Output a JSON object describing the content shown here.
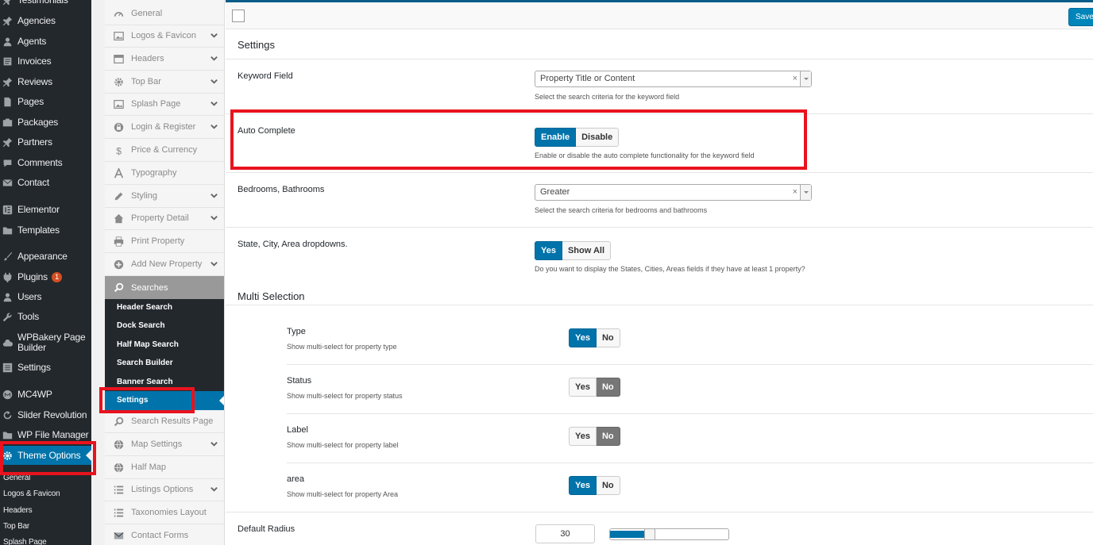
{
  "wp_menu": {
    "items": [
      {
        "label": "Testimonials",
        "icon": "pin-icon"
      },
      {
        "label": "Agencies",
        "icon": "pin-icon"
      },
      {
        "label": "Agents",
        "icon": "user-icon"
      },
      {
        "label": "Invoices",
        "icon": "document-icon"
      },
      {
        "label": "Reviews",
        "icon": "pin-icon"
      },
      {
        "label": "Pages",
        "icon": "page-icon"
      },
      {
        "label": "Packages",
        "icon": "package-icon"
      },
      {
        "label": "Partners",
        "icon": "pin-icon"
      },
      {
        "label": "Comments",
        "icon": "comment-icon"
      },
      {
        "label": "Contact",
        "icon": "mail-icon"
      },
      {
        "label": "Elementor",
        "icon": "elementor-icon"
      },
      {
        "label": "Templates",
        "icon": "folder-icon"
      },
      {
        "label": "Appearance",
        "icon": "brush-icon"
      },
      {
        "label": "Plugins",
        "icon": "plug-icon",
        "badge": "1"
      },
      {
        "label": "Users",
        "icon": "user-icon"
      },
      {
        "label": "Tools",
        "icon": "wrench-icon"
      },
      {
        "label": "WPBakery Page Builder",
        "icon": "cloud-icon"
      },
      {
        "label": "Settings",
        "icon": "settings-icon"
      },
      {
        "label": "MC4WP",
        "icon": "mc4wp-icon"
      },
      {
        "label": "Slider Revolution",
        "icon": "refresh-icon"
      },
      {
        "label": "WP File Manager",
        "icon": "folder-icon"
      },
      {
        "label": "Theme Options",
        "icon": "gear-icon"
      }
    ],
    "submenu": [
      "General",
      "Logos & Favicon",
      "Headers",
      "Top Bar",
      "Splash Page"
    ]
  },
  "options_panel": {
    "items": [
      {
        "label": "General",
        "icon": "speedometer-icon",
        "chevron": false
      },
      {
        "label": "Logos & Favicon",
        "icon": "image-icon",
        "chevron": true
      },
      {
        "label": "Headers",
        "icon": "header-icon",
        "chevron": true
      },
      {
        "label": "Top Bar",
        "icon": "gear-icon",
        "chevron": true
      },
      {
        "label": "Splash Page",
        "icon": "image-icon",
        "chevron": true
      },
      {
        "label": "Login & Register",
        "icon": "lock-icon",
        "chevron": true
      },
      {
        "label": "Price & Currency",
        "icon": "dollar-icon",
        "chevron": false
      },
      {
        "label": "Typography",
        "icon": "font-icon",
        "chevron": false
      },
      {
        "label": "Styling",
        "icon": "pencil-icon",
        "chevron": true
      },
      {
        "label": "Property Detail",
        "icon": "home-icon",
        "chevron": true
      },
      {
        "label": "Print Property",
        "icon": "print-icon",
        "chevron": false
      },
      {
        "label": "Add New Property",
        "icon": "plus-icon",
        "chevron": true
      },
      {
        "label": "Searches",
        "icon": "search-icon",
        "chevron": false
      }
    ],
    "search_submenu": [
      "Header Search",
      "Dock Search",
      "Half Map Search",
      "Search Builder",
      "Banner Search",
      "Settings"
    ],
    "items_after": [
      {
        "label": "Search Results Page",
        "icon": "search-icon",
        "chevron": false
      },
      {
        "label": "Map Settings",
        "icon": "globe-icon",
        "chevron": true
      },
      {
        "label": "Half Map",
        "icon": "globe-icon",
        "chevron": false
      },
      {
        "label": "Listings Options",
        "icon": "list-icon",
        "chevron": true
      },
      {
        "label": "Taxonomies Layout",
        "icon": "list-icon",
        "chevron": false
      },
      {
        "label": "Contact Forms",
        "icon": "mail-icon",
        "chevron": false
      }
    ]
  },
  "toolbar": {
    "save_label": "Save"
  },
  "settings": {
    "title": "Settings",
    "keyword_field": {
      "label": "Keyword Field",
      "value": "Property Title or Content",
      "clear": "×",
      "desc": "Select the search criteria for the keyword field"
    },
    "auto_complete": {
      "label": "Auto Complete",
      "enable": "Enable",
      "disable": "Disable",
      "desc": "Enable or disable the auto complete functionality for the keyword field"
    },
    "bedrooms": {
      "label": "Bedrooms, Bathrooms",
      "value": "Greater",
      "clear": "×",
      "desc": "Select the search criteria for bedrooms and bathrooms"
    },
    "dropdowns": {
      "label": "State, City, Area dropdowns.",
      "yes": "Yes",
      "show_all": "Show All",
      "desc": "Do you want to display the States, Cities, Areas fields if they have at least 1 property?"
    },
    "multi_title": "Multi Selection",
    "multi": [
      {
        "label": "Type",
        "desc": "Show multi-select for property type",
        "yes": "Yes",
        "no": "No",
        "selected": "yes"
      },
      {
        "label": "Status",
        "desc": "Show multi-select for property status",
        "yes": "Yes",
        "no": "No",
        "selected": "no"
      },
      {
        "label": "Label",
        "desc": "Show multi-select for property label",
        "yes": "Yes",
        "no": "No",
        "selected": "no"
      },
      {
        "label": "area",
        "desc": "Show multi-select for property Area",
        "yes": "Yes",
        "no": "No",
        "selected": "yes"
      }
    ],
    "radius": {
      "label": "Default Radius",
      "value": "30",
      "slider_fraction": 0.3
    }
  }
}
